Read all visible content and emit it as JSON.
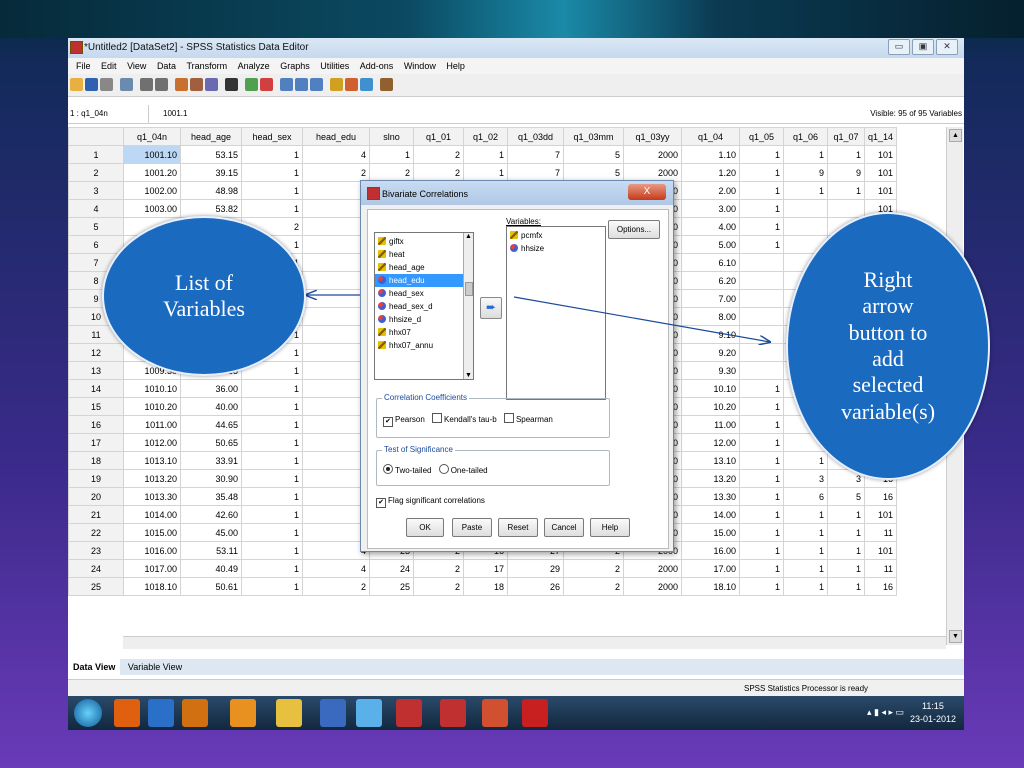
{
  "window": {
    "title": "*Untitled2 [DataSet2] - SPSS Statistics Data Editor",
    "buttons": [
      "▭",
      "▣",
      "✕"
    ]
  },
  "menu": [
    "File",
    "Edit",
    "View",
    "Data",
    "Transform",
    "Analyze",
    "Graphs",
    "Utilities",
    "Add-ons",
    "Window",
    "Help"
  ],
  "cellbar": {
    "ref": "1 : q1_04n",
    "value": "1001.1",
    "visible": "Visible: 95 of 95 Variables"
  },
  "grid": {
    "columns": [
      "q1_04n",
      "head_age",
      "head_sex",
      "head_edu",
      "slno",
      "q1_01",
      "q1_02",
      "q1_03dd",
      "q1_03mm",
      "q1_03yy",
      "q1_04",
      "q1_05",
      "q1_06",
      "q1_07",
      "q1_14"
    ],
    "rows": [
      [
        "1",
        "1001.10",
        "53.15",
        "1",
        "4",
        "1",
        "2",
        "1",
        "7",
        "5",
        "2000",
        "1.10",
        "1",
        "1",
        "1",
        "101"
      ],
      [
        "2",
        "1001.20",
        "39.15",
        "1",
        "2",
        "2",
        "2",
        "1",
        "7",
        "5",
        "2000",
        "1.20",
        "1",
        "9",
        "9",
        "101"
      ],
      [
        "3",
        "1002.00",
        "48.98",
        "1",
        "",
        "",
        "",
        "",
        "",
        "",
        "2000",
        "2.00",
        "1",
        "1",
        "1",
        "101"
      ],
      [
        "4",
        "1003.00",
        "53.82",
        "1",
        "",
        "",
        "",
        "",
        "",
        "",
        "2000",
        "3.00",
        "1",
        "",
        "",
        "101"
      ],
      [
        "5",
        "",
        "",
        "2",
        "",
        "",
        "",
        "",
        "",
        "",
        "2000",
        "4.00",
        "1",
        "",
        "",
        ""
      ],
      [
        "6",
        "",
        "",
        "1",
        "",
        "",
        "",
        "",
        "",
        "",
        "2000",
        "5.00",
        "1",
        "",
        "",
        ""
      ],
      [
        "7",
        "",
        "",
        "1",
        "",
        "",
        "",
        "",
        "",
        "",
        "2000",
        "6.10",
        "",
        "",
        "",
        ""
      ],
      [
        "8",
        "",
        "",
        "",
        "",
        "",
        "",
        "",
        "",
        "",
        "2000",
        "6.20",
        "",
        "",
        "",
        ""
      ],
      [
        "9",
        "",
        "",
        "1",
        "",
        "",
        "",
        "",
        "",
        "",
        "2000",
        "7.00",
        "",
        "",
        "",
        ""
      ],
      [
        "10",
        "",
        "",
        "1",
        "",
        "",
        "",
        "",
        "",
        "",
        "2000",
        "8.00",
        "",
        "",
        "",
        ""
      ],
      [
        "11",
        "",
        "",
        "1",
        "",
        "",
        "",
        "",
        "",
        "",
        "2000",
        "9.10",
        "",
        "",
        "",
        ""
      ],
      [
        "12",
        "1009.20",
        "44.65",
        "1",
        "",
        "",
        "",
        "",
        "",
        "",
        "2000",
        "9.20",
        "",
        "",
        "",
        ""
      ],
      [
        "13",
        "1009.30",
        "36.65",
        "1",
        "",
        "",
        "",
        "",
        "",
        "",
        "2000",
        "9.30",
        "",
        "",
        "",
        ""
      ],
      [
        "14",
        "1010.10",
        "36.00",
        "1",
        "",
        "",
        "",
        "",
        "",
        "",
        "2000",
        "10.10",
        "1",
        "",
        "",
        ""
      ],
      [
        "15",
        "1010.20",
        "40.00",
        "1",
        "",
        "",
        "",
        "",
        "",
        "",
        "2000",
        "10.20",
        "1",
        "",
        "",
        ""
      ],
      [
        "16",
        "1011.00",
        "44.65",
        "1",
        "",
        "",
        "",
        "",
        "",
        "",
        "2000",
        "11.00",
        "1",
        "",
        "",
        "16"
      ],
      [
        "17",
        "1012.00",
        "50.65",
        "1",
        "",
        "",
        "",
        "",
        "",
        "",
        "2000",
        "12.00",
        "1",
        "1",
        "1",
        "16"
      ],
      [
        "18",
        "1013.10",
        "33.91",
        "1",
        "",
        "",
        "",
        "",
        "",
        "",
        "2000",
        "13.10",
        "1",
        "1",
        "1",
        "16"
      ],
      [
        "19",
        "1013.20",
        "30.90",
        "1",
        "",
        "",
        "",
        "",
        "",
        "",
        "2000",
        "13.20",
        "1",
        "3",
        "3",
        "16"
      ],
      [
        "20",
        "1013.30",
        "35.48",
        "1",
        "",
        "",
        "",
        "",
        "",
        "",
        "2000",
        "13.30",
        "1",
        "6",
        "5",
        "16"
      ],
      [
        "21",
        "1014.00",
        "42.60",
        "1",
        "1",
        "21",
        "2",
        "14",
        "24",
        "2",
        "2000",
        "14.00",
        "1",
        "1",
        "1",
        "101"
      ],
      [
        "22",
        "1015.00",
        "45.00",
        "1",
        "2",
        "22",
        "2",
        "15",
        "28",
        "2",
        "2000",
        "15.00",
        "1",
        "1",
        "1",
        "11"
      ],
      [
        "23",
        "1016.00",
        "53.11",
        "1",
        "4",
        "23",
        "2",
        "16",
        "27",
        "2",
        "2000",
        "16.00",
        "1",
        "1",
        "1",
        "101"
      ],
      [
        "24",
        "1017.00",
        "40.49",
        "1",
        "4",
        "24",
        "2",
        "17",
        "29",
        "2",
        "2000",
        "17.00",
        "1",
        "1",
        "1",
        "11"
      ],
      [
        "25",
        "1018.10",
        "50.61",
        "1",
        "2",
        "25",
        "2",
        "18",
        "26",
        "2",
        "2000",
        "18.10",
        "1",
        "1",
        "1",
        "16"
      ]
    ]
  },
  "tabs": {
    "data_view": "Data View",
    "variable_view": "Variable View"
  },
  "status": "SPSS Statistics  Processor is ready",
  "taskbar": {
    "time": "11:15",
    "date": "23-01-2012"
  },
  "dialog": {
    "title": "Bivariate Correlations",
    "close": "X",
    "source_vars": [
      {
        "name": "giftx",
        "icon": "scale-icon"
      },
      {
        "name": "heat",
        "icon": "scale-icon"
      },
      {
        "name": "head_age",
        "icon": "scale-icon"
      },
      {
        "name": "head_edu",
        "icon": "nominal-icon"
      },
      {
        "name": "head_sex",
        "icon": "nominal-icon"
      },
      {
        "name": "head_sex_d",
        "icon": "nominal-icon"
      },
      {
        "name": "hhsize_d",
        "icon": "nominal-icon"
      },
      {
        "name": "hhx07",
        "icon": "scale-icon"
      },
      {
        "name": "hhx07_annu",
        "icon": "scale-icon"
      }
    ],
    "variables_label": "Variables:",
    "target_vars": [
      {
        "name": "pcmfx",
        "icon": "scale-icon"
      },
      {
        "name": "hhsize",
        "icon": "nominal-icon"
      }
    ],
    "options": "Options...",
    "corr_group": "Correlation Coefficients",
    "pearson": "Pearson",
    "kendall": "Kendall's tau-b",
    "spearman": "Spearman",
    "sig_group": "Test of Significance",
    "two_tailed": "Two-tailed",
    "one_tailed": "One-tailed",
    "flag": "Flag significant correlations",
    "ok": "OK",
    "paste": "Paste",
    "reset": "Reset",
    "cancel": "Cancel",
    "help": "Help"
  },
  "callouts": {
    "left": "List of\nVariables",
    "right": "Right\narrow\nbutton to\nadd\nselected\nvariable(s)"
  },
  "colors": {
    "callout": "#1a6ac0",
    "selection": "#3399ff",
    "background": "#3a2a8a"
  }
}
